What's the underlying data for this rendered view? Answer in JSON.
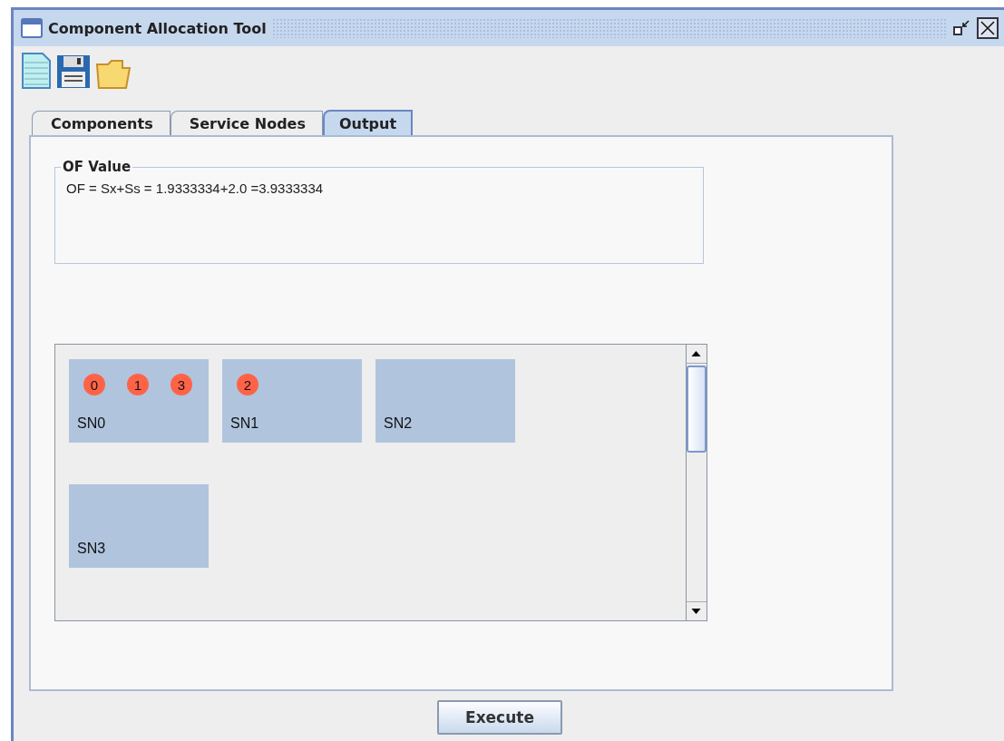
{
  "window": {
    "title": "Component Allocation Tool"
  },
  "tabs": [
    {
      "label": "Components",
      "selected": false
    },
    {
      "label": "Service Nodes",
      "selected": false
    },
    {
      "label": "Output",
      "selected": true
    }
  ],
  "of_value": {
    "legend": "OF Value",
    "text": "OF = Sx+Ss = 1.9333334+2.0 =3.9333334"
  },
  "service_nodes": [
    {
      "name": "SN0",
      "components": [
        "0",
        "1",
        "3"
      ]
    },
    {
      "name": "SN1",
      "components": [
        "2"
      ]
    },
    {
      "name": "SN2"
    },
    {
      "name": "SN3"
    }
  ],
  "execute_button": "Execute"
}
